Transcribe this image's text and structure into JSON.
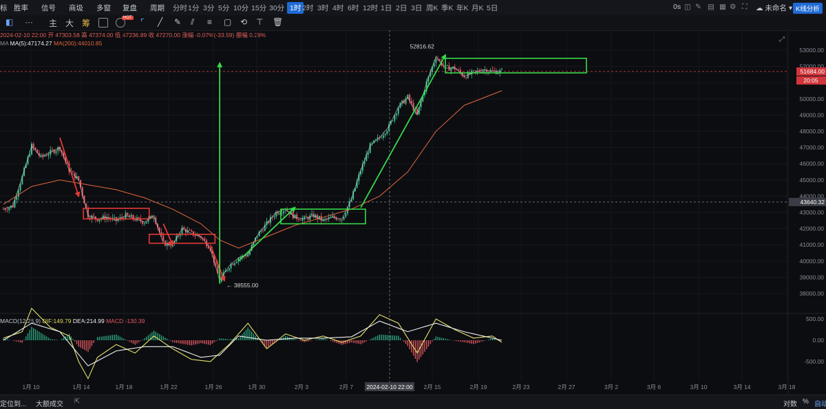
{
  "topbar": {
    "left_items": [
      "标",
      "胜率",
      "信号",
      "商圾",
      "多窗",
      "复盘",
      "周期"
    ],
    "intervals": [
      "分时",
      "1分",
      "3分",
      "5分",
      "10分",
      "15分",
      "30分",
      "1时",
      "2时",
      "3时",
      "4时",
      "6时",
      "12时",
      "1日",
      "2日",
      "3日",
      "周K",
      "季K",
      "年K",
      "月K",
      "5日"
    ],
    "active_interval": "1时",
    "right_label": "0s",
    "unnamed_label": "未命名",
    "kline_button": "K线分析",
    "hot_badge": "HOT"
  },
  "toolbar": {
    "main": "主",
    "big": "大",
    "chip": "筹"
  },
  "info": {
    "date": "2024-02-10 22:00",
    "open": "开 47303.58",
    "high": "高 47374.00",
    "low": "低 47236.89",
    "close": "收 47270.00",
    "change": "涨幅 -0.07%(-33.59)",
    "amplitude": "振幅 0.29%"
  },
  "ma": {
    "label": "MA",
    "ma5": "MA(5):47174.27",
    "ma200": "MA(200):44010.85",
    "ma5_color": "#f0f0f0",
    "ma200_color": "#e2673d"
  },
  "macd": {
    "label": "MACD(12,26,9)",
    "dif": "DIF:149.79",
    "dea": "DEA:214.99",
    "macd": "MACD:-130.39",
    "yticks": [
      500,
      0,
      -500
    ],
    "ytick_labels": [
      "500.00",
      "0.00",
      "-500.00"
    ]
  },
  "chart_data": {
    "type": "candlestick",
    "y_ticks": [
      38000,
      39000,
      40000,
      41000,
      42000,
      43000,
      44000,
      45000,
      46000,
      47000,
      48000,
      49000,
      50000,
      51000,
      52000,
      53000
    ],
    "y_tick_labels": [
      "38000.00",
      "39000.00",
      "40000.00",
      "41000.00",
      "42000.00",
      "43000.00",
      "44000.00",
      "45000.00",
      "46000.00",
      "47000.00",
      "48000.00",
      "49000.00",
      "50000.00",
      "51000.00",
      "52000.00",
      "53000.00"
    ],
    "x_labels": [
      "1月 10",
      "1月 14",
      "1月 18",
      "1月 22",
      "1月 26",
      "1月 30",
      "2月 3",
      "2月 7",
      "2月 15",
      "2月 19",
      "2月 23",
      "2月 27",
      "3月 2",
      "3月 6",
      "3月 10",
      "3月 14",
      "3月 18"
    ],
    "crosshair_date": "2024-02-10 22:00",
    "current_price": "51684.00",
    "countdown": "20:05",
    "crosshair_price": "43640.32",
    "high_annotation": "52816.62",
    "low_annotation": "38555.00",
    "waypoints": [
      [
        0,
        43200
      ],
      [
        1,
        43400
      ],
      [
        2,
        45200
      ],
      [
        3,
        47100
      ],
      [
        4,
        46400
      ],
      [
        5,
        46700
      ],
      [
        6,
        47000
      ],
      [
        7,
        45600
      ],
      [
        8,
        45000
      ],
      [
        9,
        42800
      ],
      [
        10,
        42600
      ],
      [
        11,
        42700
      ],
      [
        12,
        42500
      ],
      [
        13,
        42800
      ],
      [
        14,
        42600
      ],
      [
        15,
        42400
      ],
      [
        16,
        42800
      ],
      [
        17,
        41100
      ],
      [
        18,
        41000
      ],
      [
        19,
        42000
      ],
      [
        20,
        41700
      ],
      [
        21,
        41500
      ],
      [
        22,
        40800
      ],
      [
        23,
        38800
      ],
      [
        24,
        39700
      ],
      [
        25,
        40200
      ],
      [
        26,
        40400
      ],
      [
        27,
        41600
      ],
      [
        28,
        42300
      ],
      [
        29,
        43000
      ],
      [
        30,
        43200
      ],
      [
        31,
        42700
      ],
      [
        32,
        42600
      ],
      [
        33,
        42800
      ],
      [
        34,
        42500
      ],
      [
        35,
        42700
      ],
      [
        36,
        42600
      ],
      [
        37,
        43800
      ],
      [
        38,
        45600
      ],
      [
        39,
        47100
      ],
      [
        40,
        47600
      ],
      [
        41,
        48300
      ],
      [
        42,
        49500
      ],
      [
        43,
        50100
      ],
      [
        44,
        49000
      ],
      [
        45,
        51000
      ],
      [
        46,
        52600
      ],
      [
        47,
        51900
      ],
      [
        48,
        51900
      ],
      [
        49,
        51400
      ],
      [
        50,
        51600
      ],
      [
        51,
        51800
      ],
      [
        52,
        51700
      ],
      [
        53,
        51684
      ]
    ],
    "ma200": [
      [
        0,
        43500
      ],
      [
        3,
        44600
      ],
      [
        6,
        45000
      ],
      [
        9,
        44700
      ],
      [
        12,
        44400
      ],
      [
        15,
        43900
      ],
      [
        18,
        43200
      ],
      [
        21,
        42300
      ],
      [
        23,
        41300
      ],
      [
        25,
        40800
      ],
      [
        28,
        41500
      ],
      [
        31,
        42200
      ],
      [
        34,
        42700
      ],
      [
        37,
        43200
      ],
      [
        40,
        44000
      ],
      [
        43,
        45500
      ],
      [
        46,
        48000
      ],
      [
        49,
        49600
      ],
      [
        53,
        50500
      ]
    ],
    "red_boxes": [
      {
        "x0": 8.5,
        "x1": 15.5,
        "y0": 42600,
        "y1": 43250
      },
      {
        "x0": 15.5,
        "x1": 22.5,
        "y0": 41100,
        "y1": 41650
      }
    ],
    "green_boxes": [
      {
        "x0": 29.5,
        "x1": 38.5,
        "y0": 42300,
        "y1": 43200
      },
      {
        "x0": 47,
        "x1": 62,
        "y0": 51600,
        "y1": 52500
      }
    ],
    "red_arrows": [
      {
        "from": [
          6,
          47600
        ],
        "to": [
          8,
          44000
        ]
      },
      {
        "from": [
          17,
          42300
        ],
        "to": [
          18,
          41000
        ]
      },
      {
        "from": [
          22,
          41000
        ],
        "to": [
          23.5,
          38800
        ]
      }
    ],
    "green_arrows": [
      {
        "from": [
          23,
          38600
        ],
        "to": [
          23,
          52200
        ]
      },
      {
        "from": [
          25,
          40000
        ],
        "to": [
          31,
          43300
        ]
      },
      {
        "from": [
          38,
          43300
        ],
        "to": [
          47,
          52700
        ]
      }
    ],
    "macd_series": {
      "dif": [
        [
          0,
          50
        ],
        [
          2,
          200
        ],
        [
          3,
          750
        ],
        [
          5,
          300
        ],
        [
          7,
          100
        ],
        [
          8,
          -500
        ],
        [
          9,
          -900
        ],
        [
          10,
          -400
        ],
        [
          12,
          -100
        ],
        [
          14,
          -300
        ],
        [
          16,
          100
        ],
        [
          18,
          -200
        ],
        [
          20,
          -450
        ],
        [
          22,
          -500
        ],
        [
          24,
          -100
        ],
        [
          26,
          400
        ],
        [
          28,
          -200
        ],
        [
          30,
          150
        ],
        [
          32,
          0
        ],
        [
          34,
          100
        ],
        [
          36,
          -50
        ],
        [
          38,
          100
        ],
        [
          40,
          600
        ],
        [
          42,
          400
        ],
        [
          44,
          -300
        ],
        [
          46,
          500
        ],
        [
          48,
          250
        ],
        [
          50,
          50
        ],
        [
          52,
          100
        ],
        [
          53,
          -50
        ]
      ],
      "dea": [
        [
          0,
          0
        ],
        [
          3,
          400
        ],
        [
          6,
          200
        ],
        [
          9,
          -600
        ],
        [
          12,
          -250
        ],
        [
          15,
          -150
        ],
        [
          18,
          -150
        ],
        [
          21,
          -400
        ],
        [
          23,
          -350
        ],
        [
          25,
          100
        ],
        [
          28,
          0
        ],
        [
          31,
          50
        ],
        [
          34,
          50
        ],
        [
          37,
          80
        ],
        [
          40,
          450
        ],
        [
          43,
          200
        ],
        [
          46,
          400
        ],
        [
          49,
          200
        ],
        [
          53,
          0
        ]
      ]
    }
  },
  "bottombar": {
    "locate": "定位到...",
    "big_deals": "大额成交",
    "log": "对数",
    "percent": "%",
    "auto": "自动"
  }
}
